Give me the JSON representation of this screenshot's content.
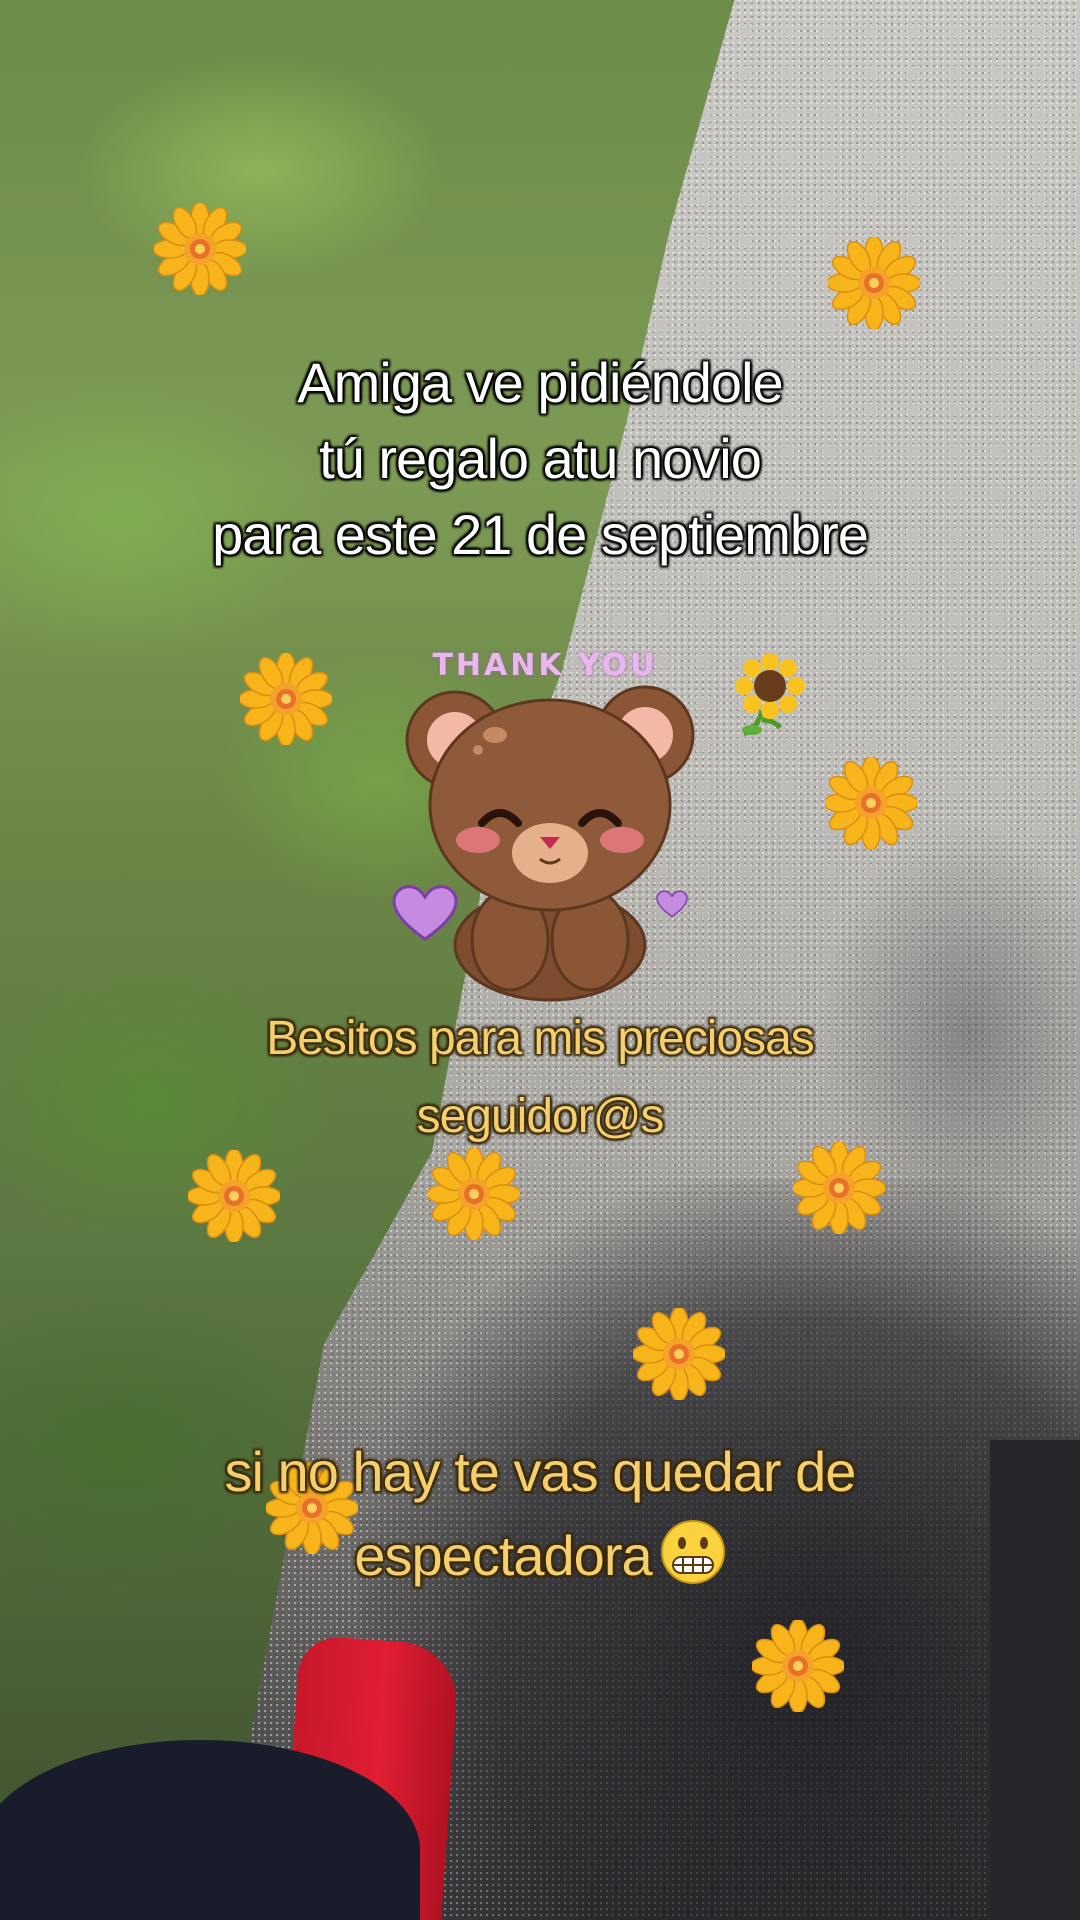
{
  "captions": {
    "top": [
      "Amiga ve pidiéndole",
      "tú regalo atu novio",
      "para este 21 de septiembre"
    ],
    "middle": [
      "Besitos para mis preciosas",
      "seguidor@s"
    ],
    "bottom": [
      "si no hay te vas quedar de",
      "espectadora"
    ]
  },
  "sticker": {
    "text": "THANK YOU",
    "icon": "teddy-bear-icon"
  },
  "emoji": "grimacing-face-icon",
  "colors": {
    "top_text": "#ffffff",
    "accent_text": "#f5cf6d",
    "flower_petal": "#f7b51b",
    "flower_center": "#e8702a",
    "bear": "#8b5636",
    "heart": "#c58be0"
  }
}
